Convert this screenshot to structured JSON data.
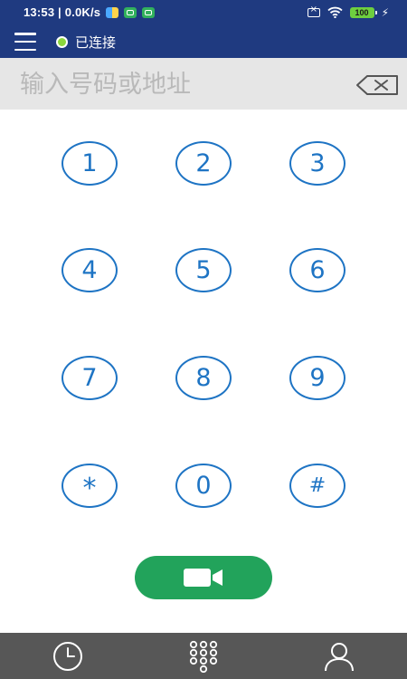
{
  "status_bar": {
    "time": "13:53 | 0.0K/s",
    "battery": "100"
  },
  "header": {
    "connection_status": "已连接"
  },
  "dial_input": {
    "placeholder": "输入号码或地址",
    "value": ""
  },
  "keypad": {
    "keys": [
      "1",
      "2",
      "3",
      "4",
      "5",
      "6",
      "7",
      "8",
      "9",
      "*",
      "0",
      "#"
    ]
  },
  "colors": {
    "primary": "#1f3a80",
    "key_outline": "#1e74c4",
    "call_green": "#22a35b",
    "connected_dot": "#8bd63c",
    "bottom_bar": "#575757"
  },
  "icons": {
    "menu": "hamburger-icon",
    "backspace": "backspace-icon",
    "call": "video-camera-icon",
    "nav": [
      "clock-icon",
      "dialpad-icon",
      "contact-icon"
    ]
  }
}
